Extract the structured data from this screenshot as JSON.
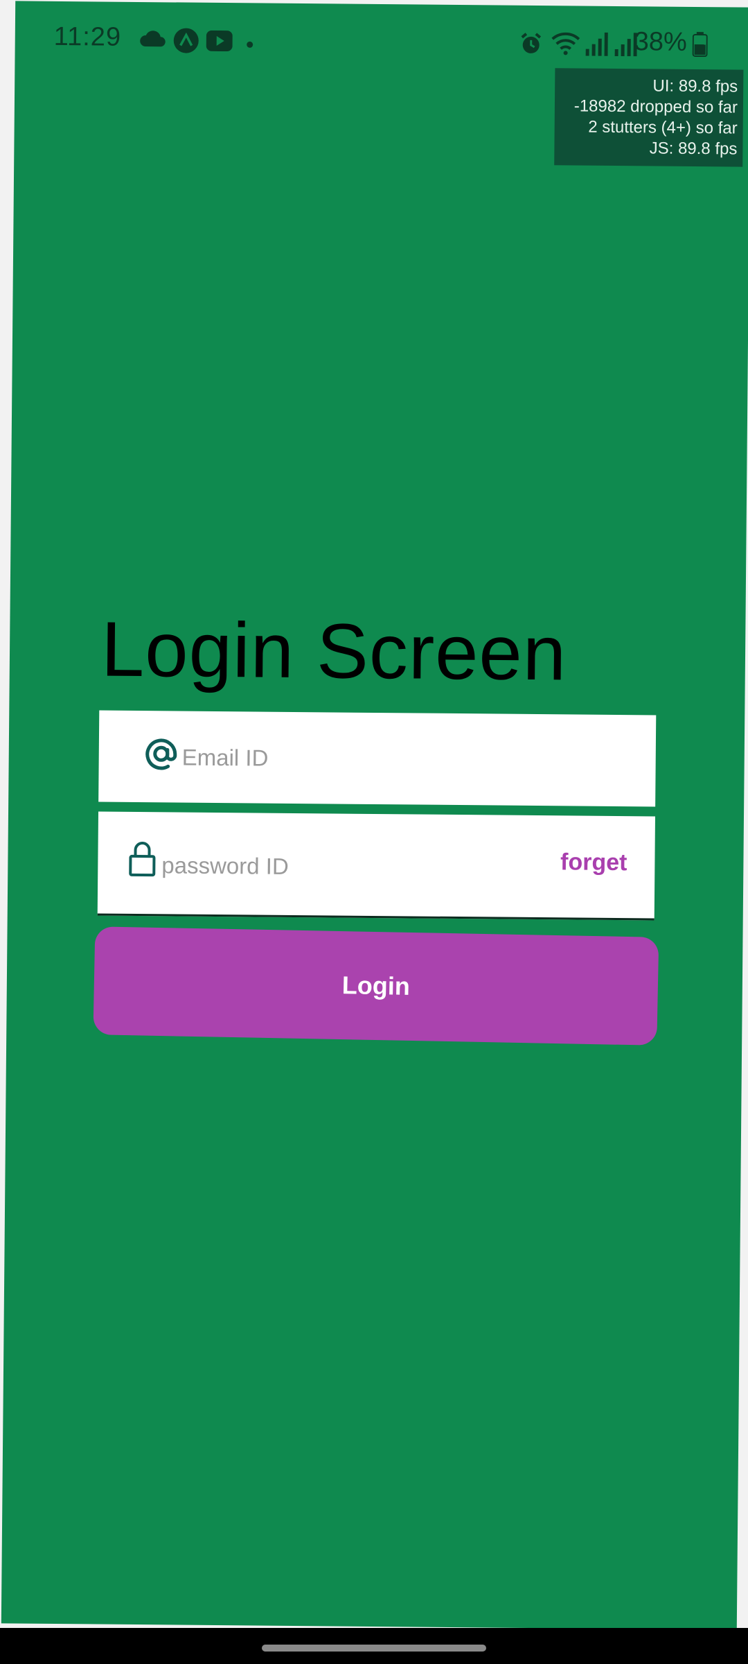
{
  "status_bar": {
    "time": "11:29",
    "battery": "38%",
    "icons": [
      "cloud-icon",
      "app-a-icon",
      "youtube-icon",
      "dot-icon",
      "alarm-icon",
      "wifi-icon",
      "signal-icon",
      "signal-icon-2",
      "battery-icon"
    ]
  },
  "perf_monitor": {
    "ui_fps": "UI: 89.8 fps",
    "dropped": "-18982 dropped so far",
    "stutters": "2 stutters (4+) so far",
    "js_fps": "JS: 89.8 fps"
  },
  "login": {
    "title": "Login Screen",
    "email_placeholder": "Email ID",
    "password_placeholder": "password ID",
    "forget_label": "forget",
    "button_label": "Login"
  },
  "colors": {
    "background": "#0f8a4f",
    "accent": "#aa43ae",
    "icon": "#0f5e59"
  }
}
